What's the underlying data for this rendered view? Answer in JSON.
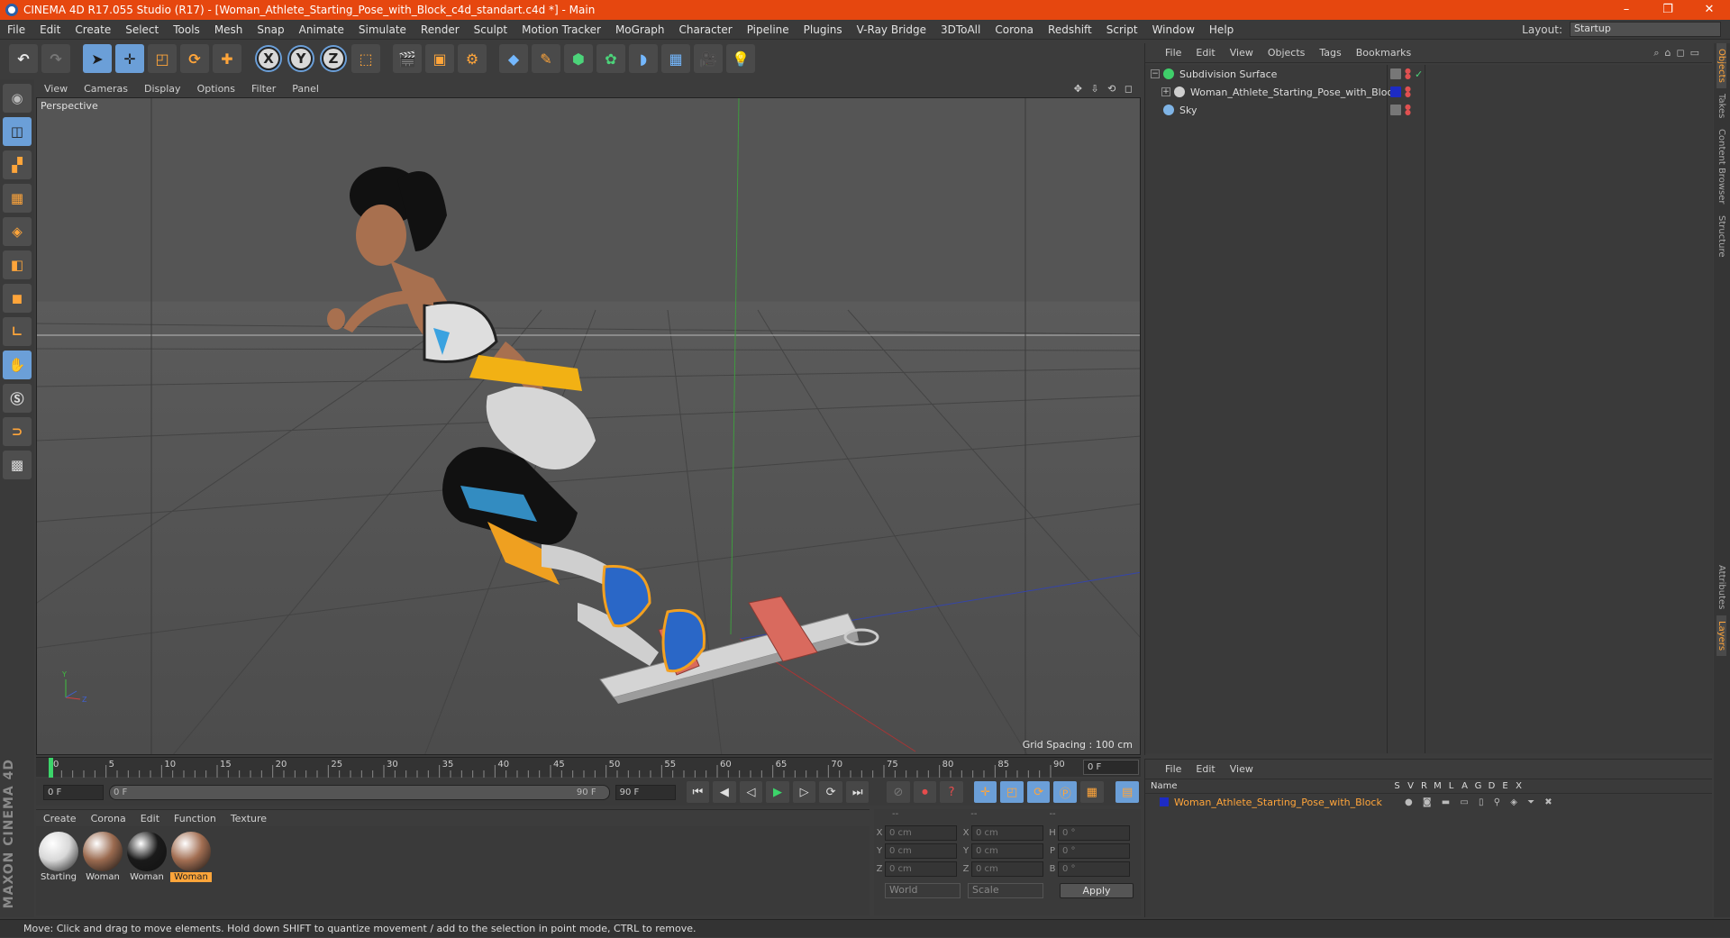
{
  "window": {
    "title": "CINEMA 4D R17.055 Studio (R17) - [Woman_Athlete_Starting_Pose_with_Block_c4d_standart.c4d *] - Main",
    "buttons": [
      "–",
      "❐",
      "✕"
    ]
  },
  "menubar": {
    "items": [
      "File",
      "Edit",
      "Create",
      "Select",
      "Tools",
      "Mesh",
      "Snap",
      "Animate",
      "Simulate",
      "Render",
      "Sculpt",
      "Motion Tracker",
      "MoGraph",
      "Character",
      "Pipeline",
      "Plugins",
      "V-Ray Bridge",
      "3DToAll",
      "Corona",
      "Redshift",
      "Script",
      "Window",
      "Help"
    ],
    "layout_label": "Layout:",
    "layout_value": "Startup"
  },
  "toolbar": {
    "icons": [
      "undo-icon",
      "redo-icon",
      "select-icon",
      "move-icon",
      "scale-icon",
      "rotate-icon",
      "live-select-icon",
      "x-axis-icon",
      "y-axis-icon",
      "z-axis-icon",
      "coordinate-system-icon",
      "render-view-icon",
      "render-picture-viewer-icon",
      "render-settings-icon",
      "cube-icon",
      "pen-icon",
      "subdivision-icon",
      "mograph-icon",
      "deformer-icon",
      "floor-icon",
      "camera-icon",
      "light-icon"
    ],
    "axis_labels": [
      "X",
      "Y",
      "Z"
    ]
  },
  "left_tools": [
    "model-mode-icon",
    "texture-mode-icon",
    "workplane-icon",
    "points-mode-icon",
    "edges-mode-icon",
    "polygons-mode-icon",
    "axis-mode-icon",
    "tweak-icon",
    "snap-icon",
    "magnet-icon",
    "lock-workplane-icon",
    "grid-icon"
  ],
  "left_brand": "MAXON CINEMA 4D",
  "viewport": {
    "menu": [
      "View",
      "Cameras",
      "Display",
      "Options",
      "Filter",
      "Panel"
    ],
    "nav_icons": "✥ ⇩ ⟲ ◻",
    "label": "Perspective",
    "grid_spacing": "Grid Spacing : 100 cm"
  },
  "timeline": {
    "ticks": [
      "0",
      "5",
      "10",
      "15",
      "20",
      "25",
      "30",
      "35",
      "40",
      "45",
      "50",
      "55",
      "60",
      "65",
      "70",
      "75",
      "80",
      "85",
      "90"
    ],
    "current_frame": "0 F"
  },
  "transport": {
    "start_field": "0 F",
    "slider_left": "0 F",
    "slider_right": "90 F",
    "end_field": "90 F"
  },
  "material_manager": {
    "menu": [
      "Create",
      "Corona",
      "Edit",
      "Function",
      "Texture"
    ],
    "materials": [
      {
        "name": "Starting",
        "color": "#d8d8d8",
        "selected": false
      },
      {
        "name": "Woman",
        "color": "#9a6a4f",
        "selected": false
      },
      {
        "name": "Woman",
        "color": "#1a1a1a",
        "selected": false
      },
      {
        "name": "Woman",
        "color": "#a26e52",
        "selected": true
      }
    ]
  },
  "coordinates": {
    "header": [
      "--",
      "--",
      "--"
    ],
    "rows": [
      {
        "a": "X",
        "v1": "0 cm",
        "b": "X",
        "v2": "0 cm",
        "c": "H",
        "v3": "0 °"
      },
      {
        "a": "Y",
        "v1": "0 cm",
        "b": "Y",
        "v2": "0 cm",
        "c": "P",
        "v3": "0 °"
      },
      {
        "a": "Z",
        "v1": "0 cm",
        "b": "Z",
        "v2": "0 cm",
        "c": "B",
        "v3": "0 °"
      }
    ],
    "mode1": "World",
    "mode2": "Scale",
    "apply": "Apply"
  },
  "object_manager": {
    "menu": [
      "File",
      "Edit",
      "View",
      "Objects",
      "Tags",
      "Bookmarks"
    ],
    "objects": [
      {
        "name": "Subdivision Surface",
        "icon_color": "#3fcf6a",
        "expander": "−",
        "indent": 0
      },
      {
        "name": "Woman_Athlete_Starting_Pose_with_Block",
        "icon_color": "#cfcfcf",
        "expander": "+",
        "indent": 1
      },
      {
        "name": "Sky",
        "icon_color": "#7fb4e6",
        "expander": "",
        "indent": 0
      }
    ]
  },
  "layer_manager": {
    "menu": [
      "File",
      "Edit",
      "View"
    ],
    "columns": [
      "Name",
      "S",
      "V",
      "R",
      "M",
      "L",
      "A",
      "G",
      "D",
      "E",
      "X"
    ],
    "layers": [
      {
        "name": "Woman_Athlete_Starting_Pose_with_Block",
        "color": "#1d2bc4"
      }
    ]
  },
  "right_tabs": [
    "Objects",
    "Takes",
    "Content Browser",
    "Structure",
    "Attributes",
    "Layers"
  ],
  "status": "Move: Click and drag to move elements. Hold down SHIFT to quantize movement / add to the selection in point mode, CTRL to remove.",
  "colors": {
    "title_bar": "#e6470f",
    "accent_orange": "#ffa53a",
    "selection_blue": "#6b9fd8"
  }
}
